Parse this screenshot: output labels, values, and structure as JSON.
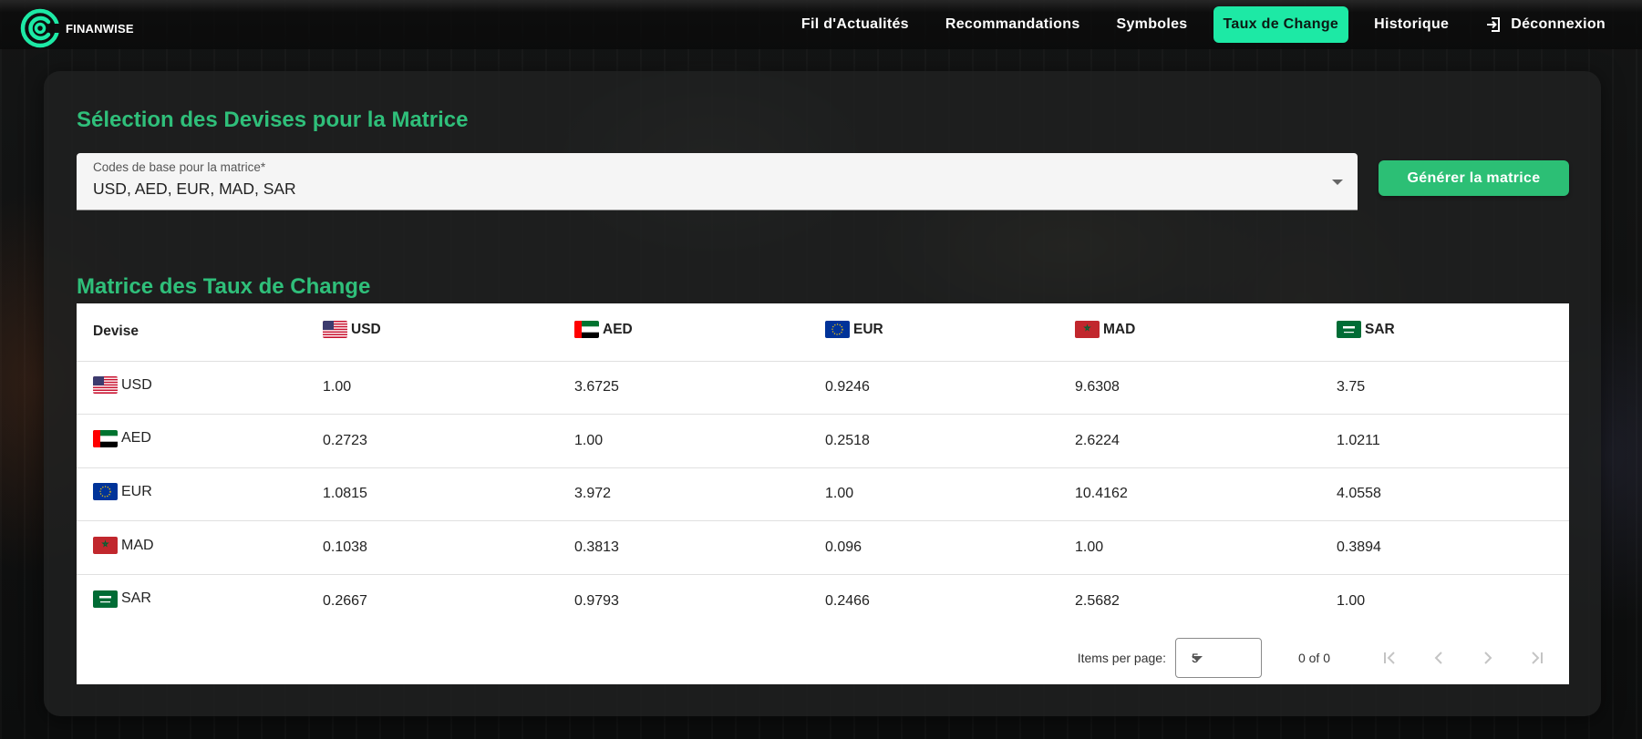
{
  "app": {
    "brand": "FINANWISE"
  },
  "nav": {
    "items": [
      {
        "label": "Fil d'Actualités",
        "active": false
      },
      {
        "label": "Recommandations",
        "active": false
      },
      {
        "label": "Symboles",
        "active": false
      },
      {
        "label": "Taux de Change",
        "active": true
      },
      {
        "label": "Historique",
        "active": false
      },
      {
        "label": "Déconnexion",
        "active": false,
        "icon": "logout-icon"
      }
    ]
  },
  "selection": {
    "title": "Sélection des Devises pour la Matrice",
    "field_label": "Codes de base pour la matrice*",
    "field_value": "USD, AED, EUR, MAD, SAR",
    "generate_label": "Générer la matrice"
  },
  "matrix": {
    "title": "Matrice des Taux de Change",
    "corner_header": "Devise",
    "columns": [
      "USD",
      "AED",
      "EUR",
      "MAD",
      "SAR"
    ],
    "flags": {
      "USD": "flag-us-icon",
      "AED": "flag-ae-icon",
      "EUR": "flag-eu-icon",
      "MAD": "flag-ma-icon",
      "SAR": "flag-sa-icon"
    },
    "rows": [
      {
        "currency": "USD",
        "values": [
          "1.00",
          "3.6725",
          "0.9246",
          "9.6308",
          "3.75"
        ]
      },
      {
        "currency": "AED",
        "values": [
          "0.2723",
          "1.00",
          "0.2518",
          "2.6224",
          "1.0211"
        ]
      },
      {
        "currency": "EUR",
        "values": [
          "1.0815",
          "3.972",
          "1.00",
          "10.4162",
          "4.0558"
        ]
      },
      {
        "currency": "MAD",
        "values": [
          "0.1038",
          "0.3813",
          "0.096",
          "1.00",
          "0.3894"
        ]
      },
      {
        "currency": "SAR",
        "values": [
          "0.2667",
          "0.9793",
          "0.2466",
          "2.5682",
          "1.00"
        ]
      }
    ]
  },
  "paginator": {
    "items_per_page_label": "Items per page:",
    "page_size": "5",
    "range_label": "0 of 0"
  },
  "colors": {
    "accent_green": "#2fbf7a",
    "nav_active": "#1de9a5",
    "button_green": "#2cbf75"
  }
}
